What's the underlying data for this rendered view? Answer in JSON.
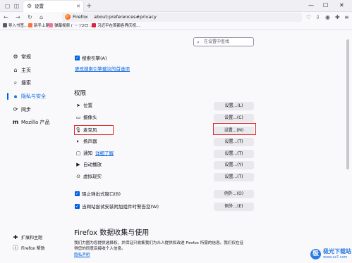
{
  "colors": {
    "accent": "#0061e0",
    "highlight": "#e02a2a",
    "watermark": "#2a7ae2"
  },
  "tab": {
    "title": "设置",
    "icon": "gear-icon"
  },
  "urlbar": {
    "brand": "Firefox",
    "url": "about:preferences#privacy"
  },
  "bookmarks": [
    {
      "label": "导入书签...",
      "color": "#5b5b66"
    },
    {
      "label": "新手上路",
      "color": "#ff7139"
    },
    {
      "label": "弹幕视频 ( ˙-˙)つロ ...",
      "color": "#fb7299"
    },
    {
      "label": "习近平在首都各界庆祝...",
      "color": "#d7263d"
    }
  ],
  "sidebar": {
    "items": [
      {
        "label": "常规",
        "icon": "gear-icon"
      },
      {
        "label": "主页",
        "icon": "home-icon"
      },
      {
        "label": "搜索",
        "icon": "search-icon"
      },
      {
        "label": "隐私与安全",
        "icon": "lock-icon"
      },
      {
        "label": "同步",
        "icon": "sync-icon"
      },
      {
        "label": "Mozilla 产品",
        "icon": "mozilla-icon"
      }
    ],
    "footer": [
      {
        "label": "扩展和主题",
        "icon": "puzzle-icon"
      },
      {
        "label": "Firefox 帮助",
        "icon": "help-icon"
      }
    ]
  },
  "search": {
    "placeholder": "在设置中查找"
  },
  "search_suggestions": {
    "checkbox_label": "搜索引擎(A)",
    "checked": true,
    "link": "更改搜索引擎建议的首选项"
  },
  "permissions": {
    "title": "权限",
    "items": [
      {
        "label": "位置",
        "icon": "location-icon",
        "button": "设置...(L)"
      },
      {
        "label": "摄像头",
        "icon": "camera-icon",
        "button": "设置...(C)"
      },
      {
        "label": "麦克风",
        "icon": "microphone-icon",
        "button": "设置...(M)"
      },
      {
        "label": "扬声器",
        "icon": "speaker-icon",
        "button": "设置...(T)"
      },
      {
        "label": "通知",
        "icon": "notification-icon",
        "link": "详细了解",
        "button": "设置...(T)"
      },
      {
        "label": "自动播放",
        "icon": "autoplay-icon",
        "button": "设置...(Y)"
      },
      {
        "label": "虚拟现实",
        "icon": "vr-icon",
        "button": "设置...(T)"
      }
    ],
    "checks": [
      {
        "label": "阻止弹出式窗口(B)",
        "checked": true,
        "button": "例外...(O)"
      },
      {
        "label": "当网站尝试安装附加组件时警告您(W)",
        "checked": true,
        "button": "例外...(E)"
      }
    ]
  },
  "data_collection": {
    "heading": "Firefox 数据收集与使用",
    "paragraph": [
      "我们力图为您提供选择权，并保证只收集我们为众人提供和改进 Firefox 所需的信息。我们仅在征",
      "得您的同意后接收个人信息。"
    ],
    "link": "隐私声明"
  },
  "watermark": {
    "logo": "极",
    "name": "极光下载站",
    "url": "www.xz7.com"
  }
}
